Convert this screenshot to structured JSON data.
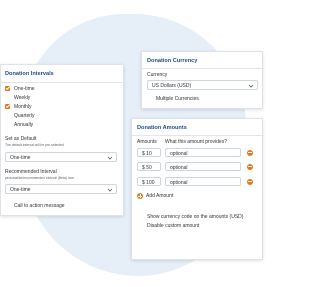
{
  "intervals": {
    "title": "Donation Intervals",
    "options": [
      {
        "label": "One-time",
        "checked": true
      },
      {
        "label": "Weekly",
        "checked": false
      },
      {
        "label": "Monthly",
        "checked": true
      },
      {
        "label": "Quarterly",
        "checked": false
      },
      {
        "label": "Annually",
        "checked": false
      }
    ],
    "default_label": "Set as Default",
    "default_hint": "The default interval will be pre-selected",
    "default_value": "One-time",
    "recommended_label": "Recommended Interval",
    "recommended_hint": "personalize/recommended interval (Beta) icon",
    "recommended_value": "One-time",
    "cta_label": "Call to action message"
  },
  "currency": {
    "title": "Donation Currency",
    "currency_label": "Currency",
    "currency_value": "US Dollars (USD)",
    "multiple_label": "Multiple Currencies"
  },
  "amounts": {
    "title": "Donation Amounts",
    "col_amount": "Amounts",
    "col_desc": "What this amount provides?",
    "rows": [
      {
        "amount": "$ 10",
        "desc": "optional"
      },
      {
        "amount": "$ 50",
        "desc": "optional"
      },
      {
        "amount": "$ 100",
        "desc": "optional"
      }
    ],
    "add_label": "Add Amount",
    "show_code_label": "Show currency code on the amounts (USD)",
    "disable_custom_label": "Disable custom amount"
  },
  "colors": {
    "accent": "#e3791f",
    "title": "#1f4e8c",
    "backdrop": "#e6eef8"
  }
}
